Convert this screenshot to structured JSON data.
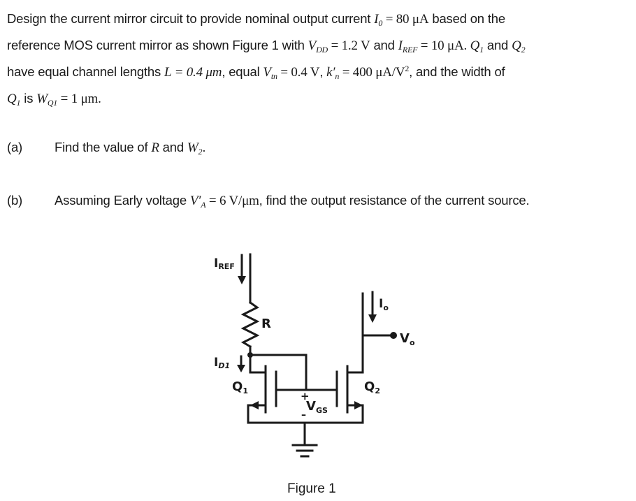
{
  "problem": {
    "line1": {
      "text_a": "Design the current mirror circuit to provide nominal output current ",
      "io_sym": "I",
      "io_sub": "0",
      "io_eq": " = 80 μA",
      "text_b": " based on the"
    },
    "line2": {
      "text_a": "reference MOS current mirror as shown Figure 1 with ",
      "vdd_sym": "V",
      "vdd_sub": "DD",
      "vdd_eq": " = 1.2 V",
      "text_b": " and ",
      "iref_sym": "I",
      "iref_sub": "REF",
      "iref_eq": " = 10 μA. ",
      "q1_sym": "Q",
      "q1_sub": "1",
      "text_c": " and ",
      "q2_sym": "Q",
      "q2_sub": "2"
    },
    "line3": {
      "text_a": "have equal channel lengths ",
      "l_eq": "L = 0.4 μm",
      "text_b": ", equal ",
      "vtn_sym": "V",
      "vtn_sub": "tn",
      "vtn_eq": " = 0.4 V",
      "text_c": ", ",
      "kn_sym": "k′",
      "kn_sub": "n",
      "kn_eq": " = 400 μA/V",
      "kn_sup": "2",
      "text_d": ", and the width of"
    },
    "line4": {
      "q1_sym": "Q",
      "q1_sub": "1",
      "text_a": " is ",
      "w_sym": "W",
      "w_sub": "Q1",
      "w_eq": " = 1 μm."
    }
  },
  "questions": [
    {
      "label": "(a)",
      "text_a": "Find the value of ",
      "r_sym": "R",
      "text_b": " and ",
      "w2_sym": "W",
      "w2_sub": "2",
      "text_c": "."
    },
    {
      "label": "(b)",
      "text_a": "Assuming Early voltage ",
      "va_sym": "V′",
      "va_sub": "A",
      "va_eq": " = 6 V/μm",
      "text_b": ", find the output resistance of the current source."
    }
  ],
  "figure": {
    "labels": {
      "iref_main": "I",
      "iref_sub": "REF",
      "r": "R",
      "id1_main": "I",
      "id1_sub": "D1",
      "q1_main": "Q",
      "q1_sub": "1",
      "q2_main": "Q",
      "q2_sub": "2",
      "io_main": "I",
      "io_sub": "o",
      "vo_main": "V",
      "vo_sub": "o",
      "vgs_main": "V",
      "vgs_sub": "GS",
      "plus": "+",
      "minus": "–"
    },
    "caption": "Figure 1"
  }
}
